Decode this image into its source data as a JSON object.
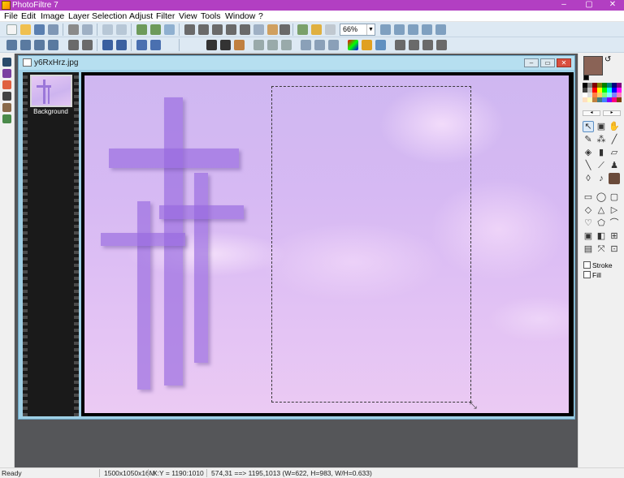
{
  "app": {
    "title": "PhotoFiltre 7",
    "window_buttons": {
      "minimize": "–",
      "maximize": "▢",
      "close": "✕"
    }
  },
  "menu": [
    "File",
    "Edit",
    "Image",
    "Layer",
    "Selection",
    "Adjust",
    "Filter",
    "View",
    "Tools",
    "Window",
    "?"
  ],
  "toolbar": {
    "zoom_value": "66%"
  },
  "document": {
    "filename": "y6RxHrz.jpg",
    "layer_label": "Background",
    "buttons": {
      "minimize": "–",
      "restore": "▭",
      "close": "✕"
    }
  },
  "colors": {
    "foreground": "#8a6356",
    "background": "#000000",
    "titlebar": "#b23fc2",
    "workspace": "#555659",
    "palette": [
      "#000000",
      "#808080",
      "#800000",
      "#808000",
      "#008000",
      "#008080",
      "#000080",
      "#800080",
      "#404040",
      "#c0c0c0",
      "#ff0000",
      "#ffff00",
      "#00ff00",
      "#00ffff",
      "#0000ff",
      "#ff00ff",
      "#ffffff",
      "#e0e0e0",
      "#ff8040",
      "#ffcc66",
      "#80ff80",
      "#80ffff",
      "#8080ff",
      "#ff80c0",
      "#ffe0c0",
      "#ffffc0",
      "#c08040",
      "#408080",
      "#4080ff",
      "#8000ff",
      "#ff0080",
      "#804000"
    ]
  },
  "tools_panel": {
    "stroke_label": "Stroke",
    "fill_label": "Fill"
  },
  "status": {
    "state": "Ready",
    "image_info": "1500x1050x16M",
    "cursor_pos": "X:Y = 1190:1010",
    "selection_info": "574,31 ==> 1195,1013 (W=622, H=983, W/H=0.633)"
  }
}
